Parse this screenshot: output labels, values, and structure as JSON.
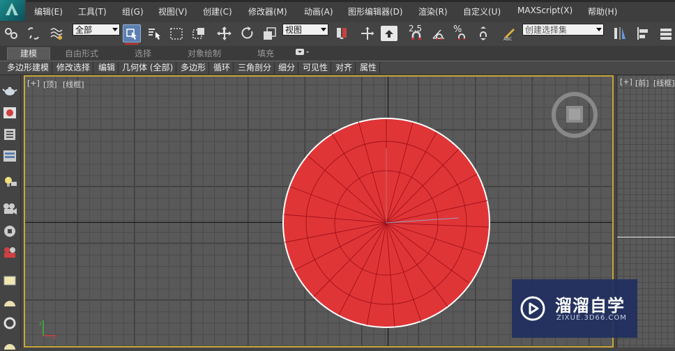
{
  "menu": {
    "items": [
      "编辑(E)",
      "工具(T)",
      "组(G)",
      "视图(V)",
      "创建(C)",
      "修改器(M)",
      "动画(A)",
      "图形编辑器(D)",
      "渲染(R)",
      "自定义(U)",
      "MAXScript(X)",
      "帮助(H)"
    ]
  },
  "toolbar": {
    "selection_filter": "全部",
    "reference_coord": "视图",
    "snap_angle_label": "2.5",
    "snap_percent_label": "%",
    "named_selection_placeholder": "创建选择集",
    "icons": [
      "link-icon",
      "unlink-icon",
      "bind-space-warp-icon",
      "select-object-icon",
      "select-by-name-icon",
      "rect-selection-icon",
      "window-crossing-icon",
      "move-icon",
      "rotate-icon",
      "scale-icon",
      "pivot-icon",
      "manipulate-icon",
      "keyboard-shortcut-icon",
      "snap-icon",
      "angle-snap-icon",
      "percent-snap-icon",
      "spinner-snap-icon",
      "edit-named-selection-icon",
      "mirror-icon",
      "align-icon"
    ]
  },
  "ribbon": {
    "tabs": [
      "建模",
      "自由形式",
      "选择",
      "对象绘制",
      "填充"
    ],
    "active_tab": "建模",
    "panels": [
      "多边形建模",
      "修改选择",
      "编辑",
      "几何体 (全部)",
      "多边形",
      "循环",
      "三角剖分",
      "细分",
      "可见性",
      "对齐",
      "属性"
    ]
  },
  "left_toolbar": {
    "icons": [
      "teapot-icon",
      "material-icon",
      "scene-explorer-icon",
      "layer-explorer-icon",
      "light-icon",
      "camera-icon",
      "helper-icon",
      "render-icon",
      "plane-icon",
      "sphere-icon",
      "torus-icon",
      "capsule-icon"
    ]
  },
  "viewport_main": {
    "label_plus": "[+]",
    "label_view": "[顶]",
    "label_shading": "[线框]",
    "object_color": "#e03537",
    "grid_color": "#595959"
  },
  "viewport_side": {
    "label_plus": "[+]",
    "label_view": "[前]",
    "label_shading": "[线框]"
  },
  "watermark": {
    "title": "溜溜自学",
    "subtitle": "ZIXUE.3D66.COM",
    "bg_color": "#212f60"
  },
  "colors": {
    "accent": "#5b7fb0",
    "viewport_border": "#c8a83a"
  }
}
